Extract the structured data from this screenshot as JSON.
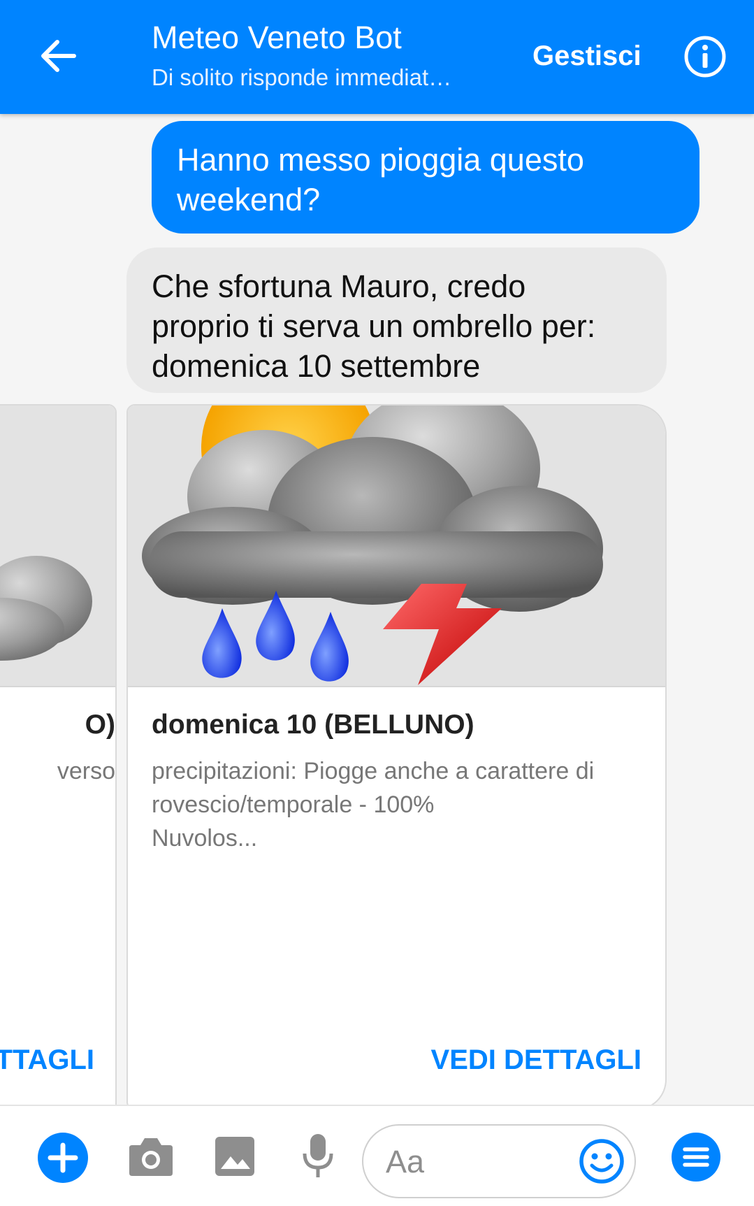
{
  "header": {
    "title": "Meteo Veneto Bot",
    "subtitle": "Di solito risponde immediat…",
    "manage_label": "Gestisci"
  },
  "messages": {
    "outgoing": "Hanno messo pioggia questo weekend?",
    "incoming": [
      "Che sfortuna Mauro, credo",
      "proprio ti serva un ombrello per:",
      "domenica 10 settembre"
    ]
  },
  "cards": {
    "previous": {
      "title_fragment": "O)",
      "desc_fragment": "verso",
      "action_fragment": "TTAGLI"
    },
    "current": {
      "title": "domenica 10 (BELLUNO)",
      "desc_lines": [
        "precipitazioni: Piogge anche a carattere di",
        "rovescio/temporale - 100%",
        "Nuvolos..."
      ],
      "action": "VEDI DETTAGLI"
    }
  },
  "composer": {
    "placeholder": "Aa"
  },
  "colors": {
    "brand": "#0084ff",
    "incoming_bubble": "#e9e9e9",
    "bottom_icons": "#8e8e8e"
  },
  "icons": [
    "back-arrow-icon",
    "info-icon",
    "plus-icon",
    "camera-icon",
    "image-icon",
    "microphone-icon",
    "emoji-icon",
    "menu-icon",
    "weather-storm-icon"
  ]
}
